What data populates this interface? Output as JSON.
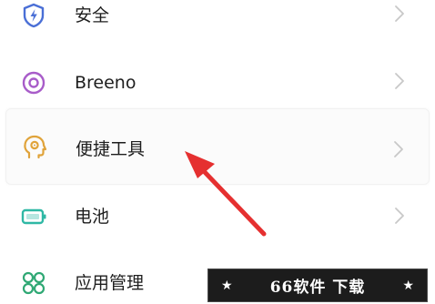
{
  "settings": {
    "items": [
      {
        "label": "安全",
        "icon": "shield-bolt-icon",
        "icon_color": "#4a6fd6"
      },
      {
        "label": "Breeno",
        "icon": "breeno-ring-icon",
        "icon_color": "#a85cc9"
      },
      {
        "label": "便捷工具",
        "icon": "head-gear-icon",
        "icon_color": "#e0a33a"
      },
      {
        "label": "电池",
        "icon": "battery-icon",
        "icon_color": "#2fb8a5"
      },
      {
        "label": "应用管理",
        "icon": "app-grid-icon",
        "icon_color": "#2fa874"
      }
    ]
  },
  "annotation": {
    "arrow_color": "#e53030"
  },
  "watermark": {
    "star_left": "★",
    "text": "66软件 下载",
    "star_right": "★"
  },
  "colors": {
    "chevron": "#c8c8c8",
    "label": "#1e1e1e"
  }
}
